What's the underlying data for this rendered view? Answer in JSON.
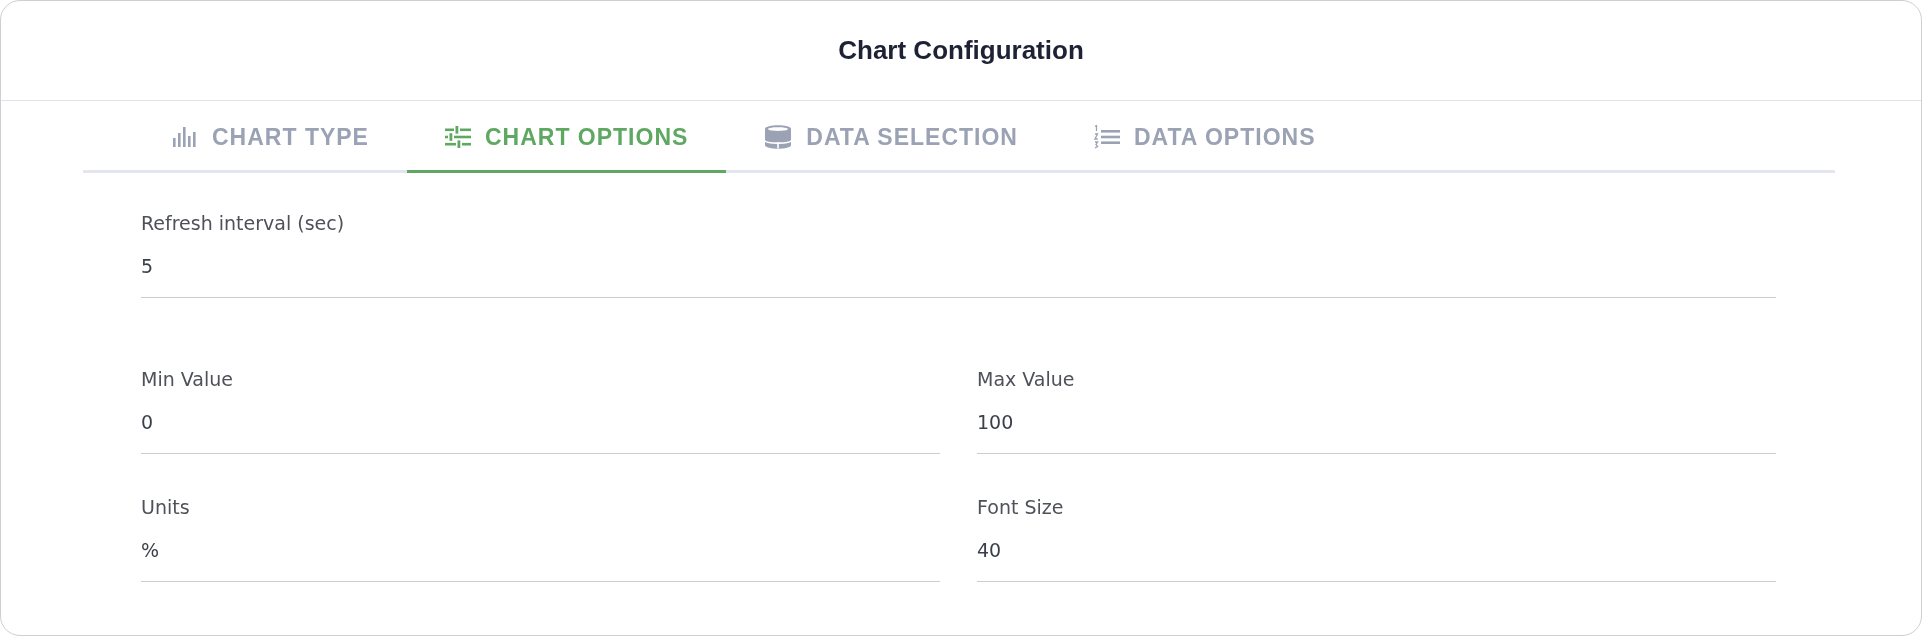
{
  "title": "Chart Configuration",
  "tabs": [
    {
      "label": "CHART TYPE",
      "selected": false
    },
    {
      "label": "CHART OPTIONS",
      "selected": true
    },
    {
      "label": "DATA SELECTION",
      "selected": false
    },
    {
      "label": "DATA OPTIONS",
      "selected": false
    }
  ],
  "form": {
    "rows": [
      {
        "fields": [
          {
            "label": "Refresh interval (sec)",
            "value": "5"
          }
        ]
      },
      {
        "fields": [
          {
            "label": "Min Value",
            "value": "0"
          },
          {
            "label": "Max Value",
            "value": "100"
          }
        ]
      },
      {
        "fields": [
          {
            "label": "Units",
            "value": "%"
          },
          {
            "label": "Font Size",
            "value": "40"
          }
        ]
      }
    ]
  }
}
